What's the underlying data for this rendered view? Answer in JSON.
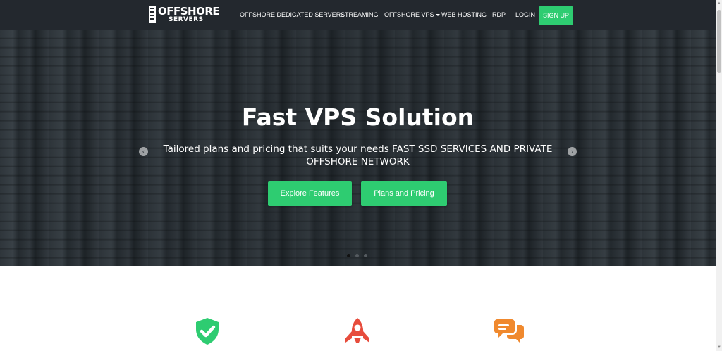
{
  "brand": {
    "line1": "OFFSHORE",
    "line2": "SERVERS"
  },
  "nav": {
    "items": [
      {
        "label": "OFFSHORE DEDICATED SERVERS"
      },
      {
        "label": "STREAMING"
      },
      {
        "label": "OFFSHORE VPS"
      },
      {
        "label": "WEB HOSTING"
      },
      {
        "label": "RDP"
      },
      {
        "label": "LOGIN"
      }
    ],
    "signup_label": "SIGN UP"
  },
  "hero": {
    "title": "Fast VPS Solution",
    "subtitle": "Tailored plans and pricing that suits your needs FAST SSD SERVICES AND PRIVATE OFFSHORE NETWORK",
    "buttons": [
      {
        "label": "Explore Features"
      },
      {
        "label": "Plans and Pricing"
      }
    ],
    "prev_arrow": "‹",
    "next_arrow": "›",
    "active_slide": 1,
    "slide_count": 3
  },
  "features": [
    {
      "icon": "shield-check-icon",
      "color": "#2ecc71"
    },
    {
      "icon": "rocket-icon",
      "color": "#e74c3c"
    },
    {
      "icon": "chat-bubbles-icon",
      "color": "#f0892e"
    }
  ],
  "colors": {
    "accent": "#2ecc71",
    "navbar": "#23282e"
  }
}
